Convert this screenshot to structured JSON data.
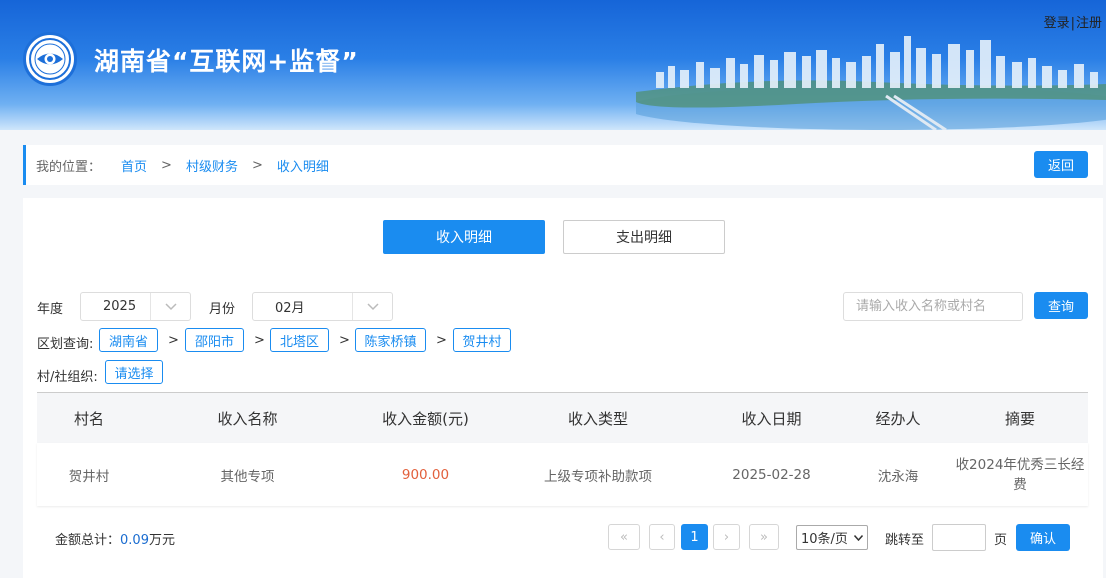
{
  "header": {
    "title": "湖南省“互联网+监督”",
    "login": "登录",
    "separator": "|",
    "register": "注册"
  },
  "breadcrumb": {
    "label": "我的位置：",
    "items": [
      "首页",
      "村级财务",
      "收入明细"
    ],
    "arrow": ">",
    "back": "返回"
  },
  "tabs": {
    "income": "收入明细",
    "expense": "支出明细"
  },
  "filters": {
    "year_label": "年度",
    "year_value": "2025",
    "month_label": "月份",
    "month_value": "02月",
    "search_placeholder": "请输入收入名称或村名",
    "query": "查询",
    "region_label": "区划查询:",
    "regions": [
      "湖南省",
      "邵阳市",
      "北塔区",
      "陈家桥镇",
      "贺井村"
    ],
    "org_label": "村/社组织:",
    "org_select": "请选择"
  },
  "table": {
    "headers": [
      "村名",
      "收入名称",
      "收入金额(元)",
      "收入类型",
      "收入日期",
      "经办人",
      "摘要"
    ],
    "rows": [
      [
        "贺井村",
        "其他专项",
        "900.00",
        "上级专项补助款项",
        "2025-02-28",
        "沈永海",
        "收2024年优秀三长经费"
      ]
    ]
  },
  "footer": {
    "total_label": "金额总计：",
    "total_value": "0.09",
    "total_unit": "万元",
    "first": "«",
    "prev": "‹",
    "current_page": "1",
    "next": "›",
    "last": "»",
    "page_size": "10条/页",
    "jump_label": "跳转至",
    "page_unit": "页",
    "confirm": "确认"
  },
  "colors": {
    "primary": "#1a8cf0",
    "amount": "#e2603c",
    "header_top": "#1665d8"
  },
  "icons": [
    "eye-logo-icon",
    "chevron-down-icon"
  ]
}
